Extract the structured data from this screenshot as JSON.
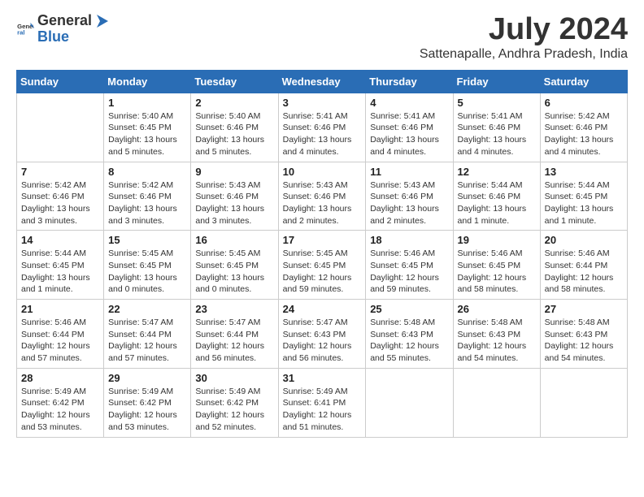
{
  "header": {
    "logo_general": "General",
    "logo_blue": "Blue",
    "month_title": "July 2024",
    "location": "Sattenapalle, Andhra Pradesh, India"
  },
  "calendar": {
    "days_of_week": [
      "Sunday",
      "Monday",
      "Tuesday",
      "Wednesday",
      "Thursday",
      "Friday",
      "Saturday"
    ],
    "weeks": [
      [
        {
          "day": "",
          "info": ""
        },
        {
          "day": "1",
          "info": "Sunrise: 5:40 AM\nSunset: 6:45 PM\nDaylight: 13 hours\nand 5 minutes."
        },
        {
          "day": "2",
          "info": "Sunrise: 5:40 AM\nSunset: 6:46 PM\nDaylight: 13 hours\nand 5 minutes."
        },
        {
          "day": "3",
          "info": "Sunrise: 5:41 AM\nSunset: 6:46 PM\nDaylight: 13 hours\nand 4 minutes."
        },
        {
          "day": "4",
          "info": "Sunrise: 5:41 AM\nSunset: 6:46 PM\nDaylight: 13 hours\nand 4 minutes."
        },
        {
          "day": "5",
          "info": "Sunrise: 5:41 AM\nSunset: 6:46 PM\nDaylight: 13 hours\nand 4 minutes."
        },
        {
          "day": "6",
          "info": "Sunrise: 5:42 AM\nSunset: 6:46 PM\nDaylight: 13 hours\nand 4 minutes."
        }
      ],
      [
        {
          "day": "7",
          "info": "Sunrise: 5:42 AM\nSunset: 6:46 PM\nDaylight: 13 hours\nand 3 minutes."
        },
        {
          "day": "8",
          "info": "Sunrise: 5:42 AM\nSunset: 6:46 PM\nDaylight: 13 hours\nand 3 minutes."
        },
        {
          "day": "9",
          "info": "Sunrise: 5:43 AM\nSunset: 6:46 PM\nDaylight: 13 hours\nand 3 minutes."
        },
        {
          "day": "10",
          "info": "Sunrise: 5:43 AM\nSunset: 6:46 PM\nDaylight: 13 hours\nand 2 minutes."
        },
        {
          "day": "11",
          "info": "Sunrise: 5:43 AM\nSunset: 6:46 PM\nDaylight: 13 hours\nand 2 minutes."
        },
        {
          "day": "12",
          "info": "Sunrise: 5:44 AM\nSunset: 6:46 PM\nDaylight: 13 hours\nand 1 minute."
        },
        {
          "day": "13",
          "info": "Sunrise: 5:44 AM\nSunset: 6:45 PM\nDaylight: 13 hours\nand 1 minute."
        }
      ],
      [
        {
          "day": "14",
          "info": "Sunrise: 5:44 AM\nSunset: 6:45 PM\nDaylight: 13 hours\nand 1 minute."
        },
        {
          "day": "15",
          "info": "Sunrise: 5:45 AM\nSunset: 6:45 PM\nDaylight: 13 hours\nand 0 minutes."
        },
        {
          "day": "16",
          "info": "Sunrise: 5:45 AM\nSunset: 6:45 PM\nDaylight: 13 hours\nand 0 minutes."
        },
        {
          "day": "17",
          "info": "Sunrise: 5:45 AM\nSunset: 6:45 PM\nDaylight: 12 hours\nand 59 minutes."
        },
        {
          "day": "18",
          "info": "Sunrise: 5:46 AM\nSunset: 6:45 PM\nDaylight: 12 hours\nand 59 minutes."
        },
        {
          "day": "19",
          "info": "Sunrise: 5:46 AM\nSunset: 6:45 PM\nDaylight: 12 hours\nand 58 minutes."
        },
        {
          "day": "20",
          "info": "Sunrise: 5:46 AM\nSunset: 6:44 PM\nDaylight: 12 hours\nand 58 minutes."
        }
      ],
      [
        {
          "day": "21",
          "info": "Sunrise: 5:46 AM\nSunset: 6:44 PM\nDaylight: 12 hours\nand 57 minutes."
        },
        {
          "day": "22",
          "info": "Sunrise: 5:47 AM\nSunset: 6:44 PM\nDaylight: 12 hours\nand 57 minutes."
        },
        {
          "day": "23",
          "info": "Sunrise: 5:47 AM\nSunset: 6:44 PM\nDaylight: 12 hours\nand 56 minutes."
        },
        {
          "day": "24",
          "info": "Sunrise: 5:47 AM\nSunset: 6:43 PM\nDaylight: 12 hours\nand 56 minutes."
        },
        {
          "day": "25",
          "info": "Sunrise: 5:48 AM\nSunset: 6:43 PM\nDaylight: 12 hours\nand 55 minutes."
        },
        {
          "day": "26",
          "info": "Sunrise: 5:48 AM\nSunset: 6:43 PM\nDaylight: 12 hours\nand 54 minutes."
        },
        {
          "day": "27",
          "info": "Sunrise: 5:48 AM\nSunset: 6:43 PM\nDaylight: 12 hours\nand 54 minutes."
        }
      ],
      [
        {
          "day": "28",
          "info": "Sunrise: 5:49 AM\nSunset: 6:42 PM\nDaylight: 12 hours\nand 53 minutes."
        },
        {
          "day": "29",
          "info": "Sunrise: 5:49 AM\nSunset: 6:42 PM\nDaylight: 12 hours\nand 53 minutes."
        },
        {
          "day": "30",
          "info": "Sunrise: 5:49 AM\nSunset: 6:42 PM\nDaylight: 12 hours\nand 52 minutes."
        },
        {
          "day": "31",
          "info": "Sunrise: 5:49 AM\nSunset: 6:41 PM\nDaylight: 12 hours\nand 51 minutes."
        },
        {
          "day": "",
          "info": ""
        },
        {
          "day": "",
          "info": ""
        },
        {
          "day": "",
          "info": ""
        }
      ]
    ]
  }
}
